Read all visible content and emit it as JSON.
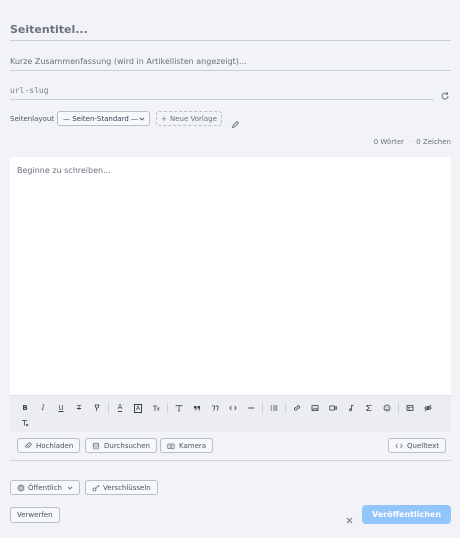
{
  "title": {
    "placeholder": "Seitentitel..."
  },
  "summary": {
    "placeholder": "Kurze Zusammenfassung (wird in Artikellisten angezeigt)..."
  },
  "slug": {
    "placeholder": "url-slug"
  },
  "layout": {
    "label": "Seitenlayout",
    "selected": "— Seiten-Standard —",
    "new_template_label": "Neue Vorlage"
  },
  "counts": {
    "words": "0 Wörter",
    "chars": "0 Zeichen"
  },
  "editor": {
    "placeholder": "Beginne zu schreiben..."
  },
  "attachments": {
    "upload_label": "Hochladen",
    "browse_label": "Durchsuchen",
    "camera_label": "Kamera",
    "source_label": "Quelltext"
  },
  "visibility": {
    "selected": "Öffentlich"
  },
  "encrypt_label": "Verschlüsseln",
  "discard_label": "Verwerfen",
  "publish_label": "Veröffentlichen",
  "colors": {
    "accent": "#93c5fd",
    "background": "#f1f3f6",
    "editor_bg": "#ffffff"
  }
}
